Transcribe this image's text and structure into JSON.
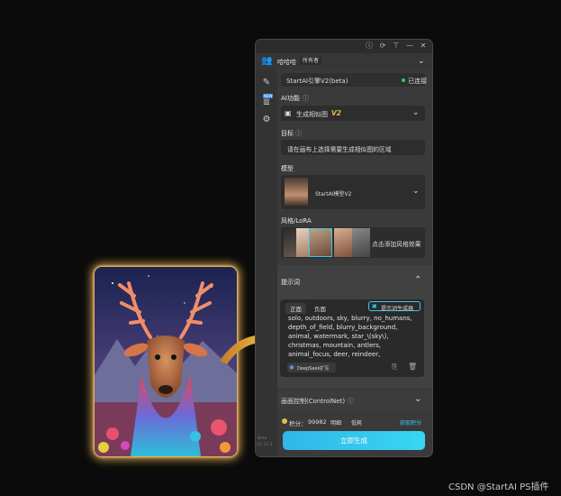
{
  "titlebar": {
    "info_icon": "info-icon",
    "refresh_icon": "refresh-icon",
    "pin_icon": "pin-icon",
    "minimize_icon": "minimize-icon",
    "close_icon": "close-icon"
  },
  "user": {
    "name": "哈哈哈",
    "role": "所有者"
  },
  "sidebar": {
    "new_badge": "NEW"
  },
  "engine": {
    "name": "StartAI引擎V2(beta)",
    "status": "已连接"
  },
  "ai_function": {
    "label": "AI功能",
    "value": "生成相似图",
    "version": "V2"
  },
  "target": {
    "label": "目标",
    "text": "请在画布上选择需要生成相似图的区域"
  },
  "model": {
    "label": "模型",
    "name": "StartAI模型V2"
  },
  "style": {
    "label": "风格/LoRA",
    "add_text": "点击添加风格效果"
  },
  "prompt": {
    "section_label": "提示词",
    "tab_positive": "正面",
    "tab_negative": "负面",
    "generator_button": "提示词生成器",
    "lines": [
      "solo, outdoors, sky, blurry, no_humans,",
      "depth_of_field, blurry_background,",
      "animal, watermark, star_\\(sky\\),",
      "christmas, mountain, antlers,",
      "animal_focus, deer, reindeer,"
    ],
    "deepseek_label": "DeepSeek扩写"
  },
  "controlnet": {
    "label": "画面控制(ControlNet)"
  },
  "footer": {
    "points_label": "积分：",
    "points_value": "99982",
    "tag1": "明细",
    "tag2": "低耗",
    "get_points": "获取积分",
    "generate_button": "立即生成",
    "version_text_1": "Beta",
    "version_text_2": "V2.11.3"
  },
  "watermark": "CSDN @StartAI PS插件",
  "colors": {
    "accent": "#39d0f0",
    "status_green": "#34d15a",
    "gold": "#e8b84a"
  }
}
